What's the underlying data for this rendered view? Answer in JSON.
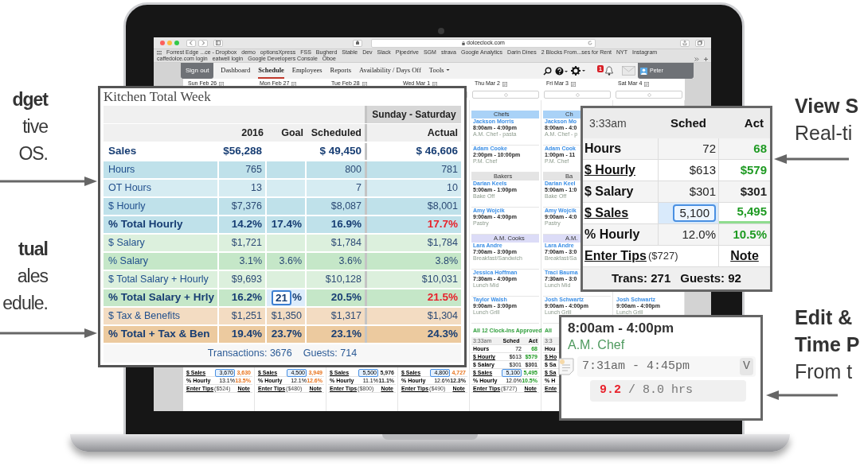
{
  "left_callouts": [
    {
      "lines": [
        {
          "text": "dget",
          "bold": true
        },
        {
          "text": "tive",
          "bold": false
        },
        {
          "text": "OS.",
          "bold": false
        }
      ]
    },
    {
      "lines": [
        {
          "text": "tual",
          "bold": true
        },
        {
          "text": "ales",
          "bold": false
        },
        {
          "text": "edule.",
          "bold": false
        }
      ]
    }
  ],
  "right_callouts": [
    {
      "lines": [
        {
          "text": "View S",
          "bold": true
        },
        {
          "text": "Real-ti",
          "bold": false
        }
      ]
    },
    {
      "lines": [
        {
          "text": "Edit &",
          "bold": true
        },
        {
          "text": "Time P",
          "bold": true
        },
        {
          "text": "From t",
          "bold": false
        }
      ]
    }
  ],
  "browser": {
    "url": "dolceclock.com",
    "bookmarks": [
      "Forrest Edge ...ce - Dropbox",
      "demo",
      "optionsXpress",
      "FSS",
      "Bugherd",
      "Stable",
      "Dev",
      "Slack",
      "Pipedrive",
      "SGM",
      "strava",
      "Google Analytics",
      "Darin Dines",
      "2 Blocks From...ses for Rent",
      "NYT",
      "Instagram",
      "caffedolce.com login",
      "eatwell login",
      "Google Developers Console",
      "Oboe"
    ]
  },
  "nav": {
    "sign_out": "Sign out",
    "links": [
      {
        "label": "Dashboard",
        "selected": false,
        "menu": false
      },
      {
        "label": "Schedule",
        "selected": true,
        "menu": false
      },
      {
        "label": "Employees",
        "selected": false,
        "menu": false
      },
      {
        "label": "Reports",
        "selected": false,
        "menu": false
      },
      {
        "label": "Availability / Days Off",
        "selected": false,
        "menu": false
      },
      {
        "label": "Tools",
        "selected": false,
        "menu": true
      }
    ],
    "alerts": "1",
    "user": "Peter"
  },
  "columns": [
    {
      "day": "Sun Feb 26",
      "summary": [
        {
          "kind": "value",
          "label": "$ Sales",
          "link": true,
          "sched": "3,670",
          "input": true,
          "act": "3,630",
          "warning": true,
          "positive": false
        },
        {
          "kind": "value",
          "label": "% Hourly",
          "link": false,
          "sched": "13.1%",
          "input": false,
          "act": "13.5%",
          "warning": true,
          "positive": false
        },
        {
          "kind": "tips",
          "label": "Enter Tips",
          "amount": "($524)",
          "note": "Note"
        }
      ]
    },
    {
      "day": "Mon Feb 27",
      "summary": [
        {
          "kind": "value",
          "label": "$ Sales",
          "link": true,
          "sched": "4,500",
          "input": true,
          "act": "3,949",
          "warning": true,
          "positive": false
        },
        {
          "kind": "value",
          "label": "% Hourly",
          "link": false,
          "sched": "12.1%",
          "input": false,
          "act": "12.6%",
          "warning": true,
          "positive": false
        },
        {
          "kind": "tips",
          "label": "Enter Tips",
          "amount": "($480)",
          "note": "Note"
        }
      ]
    },
    {
      "day": "Tue Feb 28",
      "summary": [
        {
          "kind": "value",
          "label": "$ Sales",
          "link": true,
          "sched": "5,500",
          "input": true,
          "act": "5,976",
          "warning": false,
          "positive": false
        },
        {
          "kind": "value",
          "label": "% Hourly",
          "link": false,
          "sched": "11.1%",
          "input": false,
          "act": "11.1%",
          "warning": false,
          "positive": false
        },
        {
          "kind": "tips",
          "label": "Enter Tips",
          "amount": "($800)",
          "note": "Note"
        }
      ]
    },
    {
      "day": "Wed Mar 1",
      "summary": [
        {
          "kind": "value",
          "label": "$ Sales",
          "link": true,
          "sched": "4,800",
          "input": true,
          "act": "4,727",
          "warning": true,
          "positive": false
        },
        {
          "kind": "value",
          "label": "% Hourly",
          "link": false,
          "sched": "12.6%",
          "input": false,
          "act": "12.3%",
          "warning": false,
          "positive": false
        },
        {
          "kind": "tips",
          "label": "Enter Tips",
          "amount": "($490)",
          "note": "Note"
        }
      ]
    },
    {
      "day": "Thu Mar 2",
      "sections": [
        {
          "title": "Chefs",
          "color": "#a9d2f7",
          "shifts": [
            {
              "name": "Jackson Morris",
              "time": "8:00am - 4:00pm",
              "role": "A.M. Chef - pasta"
            },
            {
              "name": "Adam Cooke",
              "time": "2:00pm - 10:00pm",
              "role": "P.M. Chef"
            }
          ]
        },
        {
          "title": "Bakers",
          "color": "#e4e4e4",
          "shifts": [
            {
              "name": "Darian Keels",
              "time": "5:00am - 1:00pm",
              "role": "Bake Off"
            },
            {
              "name": "Amy Wojcik",
              "time": "9:00am - 4:00pm",
              "role": "Pastry"
            }
          ]
        },
        {
          "title": "A.M. Cooks",
          "color": "#dcdcf7",
          "shifts": [
            {
              "name": "Lara Andre",
              "time": "7:00am - 3:00pm",
              "role": "Breakfast/Sandwich"
            },
            {
              "name": "Jessica Hoffman",
              "time": "7:30am - 4:00pm",
              "role": "Lunch Mid"
            },
            {
              "name": "Taylor Walsh",
              "time": "9:00am - 3:00pm",
              "role": "Lunch Grill"
            }
          ]
        }
      ],
      "clock_note": "All 12 Clock-Ins Approved",
      "summary": [
        {
          "kind": "header",
          "label": "3:33am",
          "sched": "Sched",
          "act": "Act"
        },
        {
          "kind": "value",
          "label": "Hours",
          "link": false,
          "sched": "72",
          "input": false,
          "act": "68",
          "warning": false,
          "positive": true
        },
        {
          "kind": "value",
          "label": "$ Hourly",
          "link": true,
          "sched": "$613",
          "input": false,
          "act": "$579",
          "warning": false,
          "positive": true
        },
        {
          "kind": "value",
          "label": "$ Salary",
          "link": false,
          "sched": "$301",
          "input": false,
          "act": "$301",
          "warning": false,
          "positive": false
        },
        {
          "kind": "value",
          "label": "$ Sales",
          "link": true,
          "sched": "5,100",
          "input": true,
          "act": "5,495",
          "warning": false,
          "positive": true
        },
        {
          "kind": "value",
          "label": "% Hourly",
          "link": false,
          "sched": "12.0%",
          "input": false,
          "act": "10.5%",
          "warning": false,
          "positive": true
        },
        {
          "kind": "tips",
          "label": "Enter Tips",
          "amount": "($727)",
          "note": "Note"
        }
      ]
    },
    {
      "day": "Fri Mar 3",
      "sections": [
        {
          "title": "Ch",
          "color": "#a9d2f7",
          "shifts": [
            {
              "name": "Jackson Mo",
              "time": "8:00am - 4:0",
              "role": "A.M. Chef - p"
            },
            {
              "name": "Adam Cook",
              "time": "1:00pm - 11",
              "role": "P.M. Chef"
            }
          ]
        },
        {
          "title": "Ba",
          "color": "#e4e4e4",
          "shifts": [
            {
              "name": "Darian Keel",
              "time": "5:00am - 1:0",
              "role": "Bake Off"
            },
            {
              "name": "Amy Wojcik",
              "time": "9:00am - 4:0",
              "role": "Pastry"
            }
          ]
        },
        {
          "title": "A.M.",
          "color": "#dcdcf7",
          "shifts": [
            {
              "name": "Lara Andre",
              "time": "7:00am - 3:0",
              "role": "Breakfast/Sa"
            },
            {
              "name": "Traci Bauma",
              "time": "7:30am - 3:0",
              "role": "Lunch Mid"
            },
            {
              "name": "Josh Schwartz",
              "time": "9:00am - 4:00pm",
              "role": "Lunch Grill"
            }
          ]
        }
      ],
      "clock_note": "All",
      "summary": [
        {
          "kind": "header",
          "label": "3:3"
        },
        {
          "kind": "value",
          "label": "Hou",
          "link": false
        },
        {
          "kind": "value",
          "label": "$ Ho",
          "link": true
        },
        {
          "kind": "value",
          "label": "$ Sa",
          "link": false
        },
        {
          "kind": "value",
          "label": "$ Sa",
          "link": true
        },
        {
          "kind": "value",
          "label": "% H",
          "link": false
        },
        {
          "kind": "tips",
          "label": "Ente"
        }
      ]
    },
    {
      "day": "Sat Mar 4",
      "sections": [
        {
          "shifts": [
            {
              "name": "Josh Schwartz",
              "time": "9:00am - 4:00pm",
              "role": "Lunch Grill"
            }
          ]
        }
      ]
    }
  ],
  "kitchen_panel": {
    "title": "Kitchen Total Week",
    "range": "Sunday - Saturday",
    "columns": [
      "2016",
      "Goal",
      "Scheduled",
      "Actual"
    ],
    "rows": [
      {
        "label": "Sales",
        "color": "#ffffff",
        "emphasis": true,
        "prior": "$56,288",
        "scheduled": "$ 49,450",
        "actual": "$ 46,606",
        "alert": false,
        "goal_editable": false
      },
      {
        "label": "Hours",
        "color": "#bfe1ea",
        "emphasis": false,
        "prior": "765",
        "scheduled": "800",
        "actual": "781",
        "alert": false,
        "goal_editable": false
      },
      {
        "label": "OT Hours",
        "color": "#d6ecf2",
        "emphasis": false,
        "prior": "13",
        "scheduled": "7",
        "actual": "10",
        "alert": false,
        "goal_editable": false
      },
      {
        "label": "$ Hourly",
        "color": "#bfe1ea",
        "emphasis": false,
        "prior": "$7,376",
        "scheduled": "$8,087",
        "actual": "$8,001",
        "alert": false,
        "goal_editable": false
      },
      {
        "label": "% Total Hourly",
        "color": "#bfe1ea",
        "emphasis": true,
        "prior": "14.2%",
        "goal": "17.4%",
        "scheduled": "16.9%",
        "actual": "17.7%",
        "alert": true,
        "goal_editable": false
      },
      {
        "label": "$ Salary",
        "color": "#dcf0dd",
        "emphasis": false,
        "prior": "$1,721",
        "scheduled": "$1,784",
        "actual": "$1,784",
        "alert": false,
        "goal_editable": false
      },
      {
        "label": "% Salary",
        "color": "#c5e7c8",
        "emphasis": false,
        "prior": "3.1%",
        "goal": "3.6%",
        "scheduled": "3.6%",
        "actual": "3.8%",
        "alert": false,
        "goal_editable": false
      },
      {
        "label": "$ Total Salary + Hourly",
        "color": "#dcf0dd",
        "emphasis": false,
        "prior": "$9,693",
        "scheduled": "$10,128",
        "actual": "$10,031",
        "alert": false,
        "goal_editable": false
      },
      {
        "label": "% Total Salary + Hrly",
        "color": "#c5e7c8",
        "emphasis": true,
        "prior": "16.2%",
        "goal": "21",
        "goal_suffix": "%",
        "scheduled": "20.5%",
        "actual": "21.5%",
        "alert": true,
        "goal_editable": true
      },
      {
        "label": "$ Tax & Benefits",
        "color": "#f3dcc2",
        "emphasis": false,
        "prior": "$1,251",
        "goal": "$1,350",
        "scheduled": "$1,317",
        "actual": "$1,304",
        "alert": false,
        "goal_editable": false
      },
      {
        "label": "% Total + Tax & Ben",
        "color": "#ecca9f",
        "emphasis": true,
        "prior": "19.4%",
        "goal": "23.7%",
        "scheduled": "23.1%",
        "actual": "24.3%",
        "alert": false,
        "goal_editable": false
      }
    ],
    "footer": [
      "Transactions: 3676",
      "Guests: 714"
    ]
  },
  "live_panel": {
    "time": "3:33am",
    "columns": [
      "Sched",
      "Act"
    ],
    "rows": [
      {
        "label": "Hours",
        "link": false,
        "sched": "72",
        "input": false,
        "act": "68",
        "color": "#1e9a22"
      },
      {
        "label": "$ Hourly",
        "link": true,
        "sched": "$613",
        "input": false,
        "act": "$579",
        "color": "#1e9a22"
      },
      {
        "label": "$ Salary",
        "link": false,
        "sched": "$301",
        "input": false,
        "act": "$301",
        "color": "#222222"
      },
      {
        "label": "$ Sales",
        "link": true,
        "sched": "5,100",
        "input": true,
        "act": "5,495",
        "color": "#1e9a22"
      },
      {
        "label": "% Hourly",
        "link": false,
        "sched": "12.0%",
        "input": false,
        "act": "10.5%",
        "color": "#1e9a22"
      }
    ],
    "tips": {
      "label": "Enter Tips",
      "amount": "($727)",
      "note": "Note"
    },
    "footer": [
      "Trans: 271",
      "Guests: 92"
    ]
  },
  "punch_panel": {
    "shift": "8:00am - 4:00pm",
    "role": "A.M. Chef",
    "punch": "7:31am - 4:45pm",
    "verify": "V",
    "actual_hours": "9.2",
    "over": true,
    "scheduled_hours": "/ 8.0 hrs"
  }
}
